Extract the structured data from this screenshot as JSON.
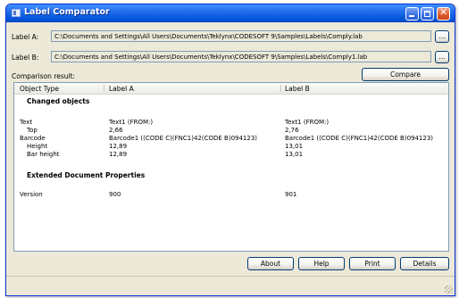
{
  "window": {
    "title": "Label Comparator"
  },
  "label_a": {
    "label": "Label A:",
    "path": "C:\\Documents and Settings\\All Users\\Documents\\Teklynx\\CODESOFT 9\\Samples\\Labels\\Comply.lab",
    "browse": "..."
  },
  "label_b": {
    "label": "Label B:",
    "path": "C:\\Documents and Settings\\All Users\\Documents\\Teklynx\\CODESOFT 9\\Samples\\Labels\\Comply1.lab",
    "browse": "..."
  },
  "comparison": {
    "label": "Comparison result:",
    "compare_button": "Compare"
  },
  "grid": {
    "columns": [
      "Object Type",
      "Label A",
      "Label B"
    ],
    "sections": [
      {
        "title": "Changed objects",
        "rows": [
          {
            "type": "Text",
            "a": "Text1 (FROM:)",
            "b": "Text1 (FROM:)"
          },
          {
            "type": "Top",
            "a": "2,66",
            "b": "2,76"
          },
          {
            "type": "Barcode",
            "a": "Barcode1 ((CODE C)(FNC1)42(CODE B)094123)",
            "b": "Barcode1 ((CODE C)(FNC1)42(CODE B)094123)"
          },
          {
            "type": "Height",
            "a": "12,89",
            "b": "13,01"
          },
          {
            "type": "Bar height",
            "a": "12,89",
            "b": "13,01"
          }
        ]
      },
      {
        "title": "Extended Document Properties",
        "rows": [
          {
            "type": "Version",
            "a": "900",
            "b": "901"
          }
        ]
      }
    ]
  },
  "footer": {
    "about": "About",
    "help": "Help",
    "print": "Print",
    "details": "Details"
  }
}
